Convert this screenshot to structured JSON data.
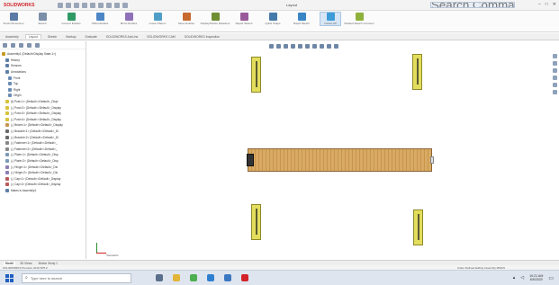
{
  "window": {
    "app_logo": "SOLIDWORKS",
    "doc_title": "Layout",
    "search_placeholder": "Search Commands",
    "controls": [
      "–",
      "□",
      "✕"
    ]
  },
  "ribbon": {
    "buttons": [
      {
        "label": "Smart Dimension",
        "icon": "smart-dimension-icon",
        "color": "#5b7aa6"
      },
      {
        "label": "Sketch",
        "icon": "sketch-icon",
        "color": "#7b8fa8"
      },
      {
        "label": "Convert Entities",
        "icon": "convert-entities-icon",
        "color": "#2f9a64"
      },
      {
        "label": "Offset Entities",
        "icon": "offset-icon",
        "color": "#4d86c6"
      },
      {
        "label": "Mirror Entities",
        "icon": "mirror-icon",
        "color": "#8e71b8"
      },
      {
        "label": "Linear Pattern",
        "icon": "linear-pattern-icon",
        "color": "#4f9ec7"
      },
      {
        "label": "Move Entities",
        "icon": "move-icon",
        "color": "#c66a2f"
      },
      {
        "label": "Display/Delete Relations",
        "icon": "relations-icon",
        "color": "#6e8f33"
      },
      {
        "label": "Repair Sketch",
        "icon": "repair-icon",
        "color": "#9a5a9a"
      },
      {
        "label": "Quick Snaps",
        "icon": "snap-icon",
        "color": "#447aa9"
      },
      {
        "label": "Rapid Sketch",
        "icon": "rapid-sketch-icon",
        "color": "#3a85c6"
      },
      {
        "label": "Instant 2D",
        "icon": "instant2d-icon",
        "color": "#3d9bd8"
      },
      {
        "label": "Shaded Sketch Contours",
        "icon": "contours-icon",
        "color": "#8fb13c"
      }
    ],
    "active_index": 11
  },
  "tabs": [
    "Assembly",
    "Layout",
    "Sketch",
    "Markup",
    "Evaluate",
    "SOLIDWORKS Add-Ins",
    "SOLIDWORKS CAM",
    "SOLIDWORKS Inspection"
  ],
  "active_tab": 1,
  "feature_tree": {
    "items": [
      {
        "label": "Assembly1 (Default<Display State-1>)",
        "level": 0,
        "color": "#c59a1f"
      },
      {
        "label": "History",
        "level": 1,
        "color": "#5d7ea6"
      },
      {
        "label": "Sensors",
        "level": 1,
        "color": "#5d7ea6"
      },
      {
        "label": "Annotations",
        "level": 1,
        "color": "#5d7ea6"
      },
      {
        "label": "Front",
        "level": 2,
        "color": "#6b8db5"
      },
      {
        "label": "Top",
        "level": 2,
        "color": "#6b8db5"
      },
      {
        "label": "Right",
        "level": 2,
        "color": "#6b8db5"
      },
      {
        "label": "Origin",
        "level": 2,
        "color": "#6b8db5"
      },
      {
        "label": "(f) Post<1> (Default<<Default>_Displ",
        "level": 1,
        "color": "#d8c23c"
      },
      {
        "label": "(-) Post<2> (Default<<Default>_Display",
        "level": 1,
        "color": "#d8c23c"
      },
      {
        "label": "(-) Post<3> (Default<<Default>_Display",
        "level": 1,
        "color": "#d8c23c"
      },
      {
        "label": "(-) Post<4> (Default<<Default>_Display",
        "level": 1,
        "color": "#d8c23c"
      },
      {
        "label": "(-) Beam<1> (Default<<Default>_Display",
        "level": 1,
        "color": "#c8954e"
      },
      {
        "label": "(-) Bracket<1> (Default<<Default>_Di",
        "level": 1,
        "color": "#6a6a6a"
      },
      {
        "label": "(-) Bracket<2> (Default<<Default>_Di",
        "level": 1,
        "color": "#6a6a6a"
      },
      {
        "label": "(-) Fastener<1> (Default<<Default>_",
        "level": 1,
        "color": "#888888"
      },
      {
        "label": "(-) Fastener<2> (Default<<Default>_",
        "level": 1,
        "color": "#888888"
      },
      {
        "label": "(-) Plate<1> (Default<<Default>_Disp",
        "level": 1,
        "color": "#7a9ab8"
      },
      {
        "label": "(-) Plate<2> (Default<<Default>_Disp",
        "level": 1,
        "color": "#7a9ab8"
      },
      {
        "label": "(-) Hinge<1> (Default<<Default>_Dis",
        "level": 1,
        "color": "#8d7db8"
      },
      {
        "label": "(-) Hinge<2> (Default<<Default>_Dis",
        "level": 1,
        "color": "#8d7db8"
      },
      {
        "label": "(-) Cap<1> (Default<<Default>_Display",
        "level": 1,
        "color": "#b85a5a"
      },
      {
        "label": "(-) Cap<2> (Default<<Default>_Display",
        "level": 1,
        "color": "#b85a5a"
      },
      {
        "label": "Mates in Assembly1",
        "level": 1,
        "color": "#5d7ea6"
      }
    ]
  },
  "viewport": {
    "triad_label": "*Isometric"
  },
  "bottom_tabs": [
    "Model",
    "3D Views",
    "Motion Study 1"
  ],
  "active_bottom_tab": 0,
  "status": {
    "left": "SOLIDWORKS Premium 2019 SP5.0",
    "right": "Under Defined   Editing Assembly   MMGS"
  },
  "taskbar": {
    "search_placeholder": "Type here to search",
    "apps": [
      {
        "icon": "task-view-icon",
        "color": "#5a6f8c"
      },
      {
        "icon": "file-explorer-icon",
        "color": "#e2b53a"
      },
      {
        "icon": "chrome-icon",
        "color": "#4caf50"
      },
      {
        "icon": "edge-icon",
        "color": "#2f7fd1"
      },
      {
        "icon": "mail-icon",
        "color": "#3a78c2"
      },
      {
        "icon": "solidworks-icon",
        "color": "#d2232a"
      }
    ],
    "time": "10:21 AM",
    "date": "6/5/2020"
  }
}
